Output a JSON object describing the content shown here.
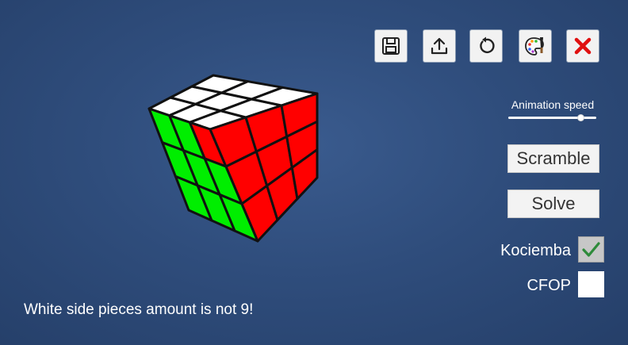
{
  "toolbar": {
    "buttons": [
      {
        "icon": "save-icon"
      },
      {
        "icon": "upload-icon"
      },
      {
        "icon": "reset-icon"
      },
      {
        "icon": "palette-icon"
      },
      {
        "icon": "close-icon"
      }
    ],
    "close_color": "#e01010"
  },
  "cube": {
    "top_face": [
      "white",
      "white",
      "white",
      "white",
      "white",
      "white",
      "white",
      "white",
      "white"
    ],
    "left_face": [
      "green",
      "green",
      "red",
      "green",
      "green",
      "green",
      "green",
      "green",
      "green"
    ],
    "right_face": [
      "red",
      "red",
      "red",
      "red",
      "red",
      "red",
      "red",
      "red",
      "red"
    ],
    "colors": {
      "white": "#ffffff",
      "green": "#00ee00",
      "red": "#ff0000",
      "edge": "#111111"
    }
  },
  "animation_speed": {
    "label": "Animation speed",
    "value_fraction": 0.82
  },
  "actions": {
    "scramble_label": "Scramble",
    "solve_label": "Solve"
  },
  "solvers": [
    {
      "label": "Kociemba",
      "checked": true
    },
    {
      "label": "CFOP",
      "checked": false
    }
  ],
  "status": {
    "message": "White side pieces amount is not 9!"
  }
}
